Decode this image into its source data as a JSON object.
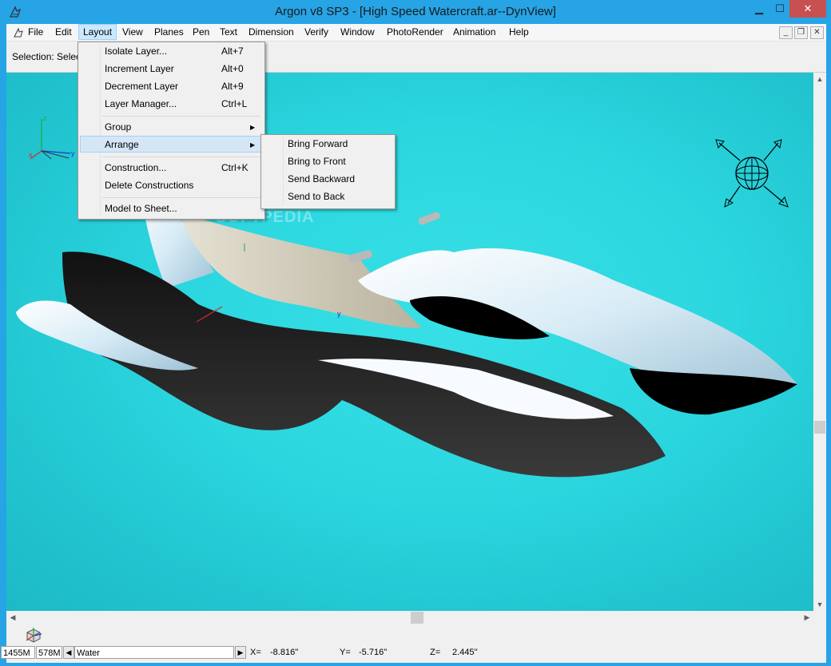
{
  "window": {
    "title": "Argon v8 SP3 - [High Speed Watercraft.ar--DynView]",
    "minimize": "▁",
    "maximize": "☐",
    "close": "✕"
  },
  "menubar": {
    "items": [
      "File",
      "Edit",
      "Layout",
      "View",
      "Planes",
      "Pen",
      "Text",
      "Dimension",
      "Verify",
      "Window",
      "PhotoRender",
      "Animation",
      "Help"
    ],
    "active": "Layout",
    "mdi_min": "_",
    "mdi_restore": "❐",
    "mdi_close": "✕"
  },
  "toolbar": {
    "selection_text": "Selection: Select."
  },
  "layout_menu": {
    "items": [
      {
        "label": "Isolate Layer...",
        "shortcut": "Alt+7"
      },
      {
        "label": "Increment Layer",
        "shortcut": "Alt+0"
      },
      {
        "label": "Decrement Layer",
        "shortcut": "Alt+9"
      },
      {
        "label": "Layer Manager...",
        "shortcut": "Ctrl+L"
      },
      {
        "label": "Group",
        "submenu": true
      },
      {
        "label": "Arrange",
        "submenu": true,
        "highlighted": true
      },
      {
        "label": "Construction...",
        "shortcut": "Ctrl+K"
      },
      {
        "label": "Delete Constructions",
        "shortcut": ""
      },
      {
        "label": "Model to Sheet...",
        "shortcut": ""
      }
    ],
    "submenu_arrow": "▶"
  },
  "arrange_submenu": {
    "items": [
      "Bring Forward",
      "Bring to Front",
      "Send Backward",
      "Send to Back"
    ]
  },
  "viewport": {
    "axis_labels": {
      "z": "z",
      "x": "x",
      "y": "y"
    },
    "model_axis_y": "y",
    "watermark": "SOFTPEDIA",
    "colors": {
      "background": "#2bd6df",
      "hull_light": "#e8f4ff",
      "hull_dark": "#000000",
      "seat": "#cfcab8"
    }
  },
  "statusbar": {
    "memory1": "1455M",
    "memory2": "578M",
    "layer": "Water",
    "x_label": "X=",
    "x_value": "-8.816''",
    "y_label": "Y=",
    "y_value": "-5.716''",
    "z_label": "Z=",
    "z_value": "2.445''"
  },
  "scroll": {
    "up": "▲",
    "down": "▼",
    "left": "◀",
    "right": "▶"
  }
}
